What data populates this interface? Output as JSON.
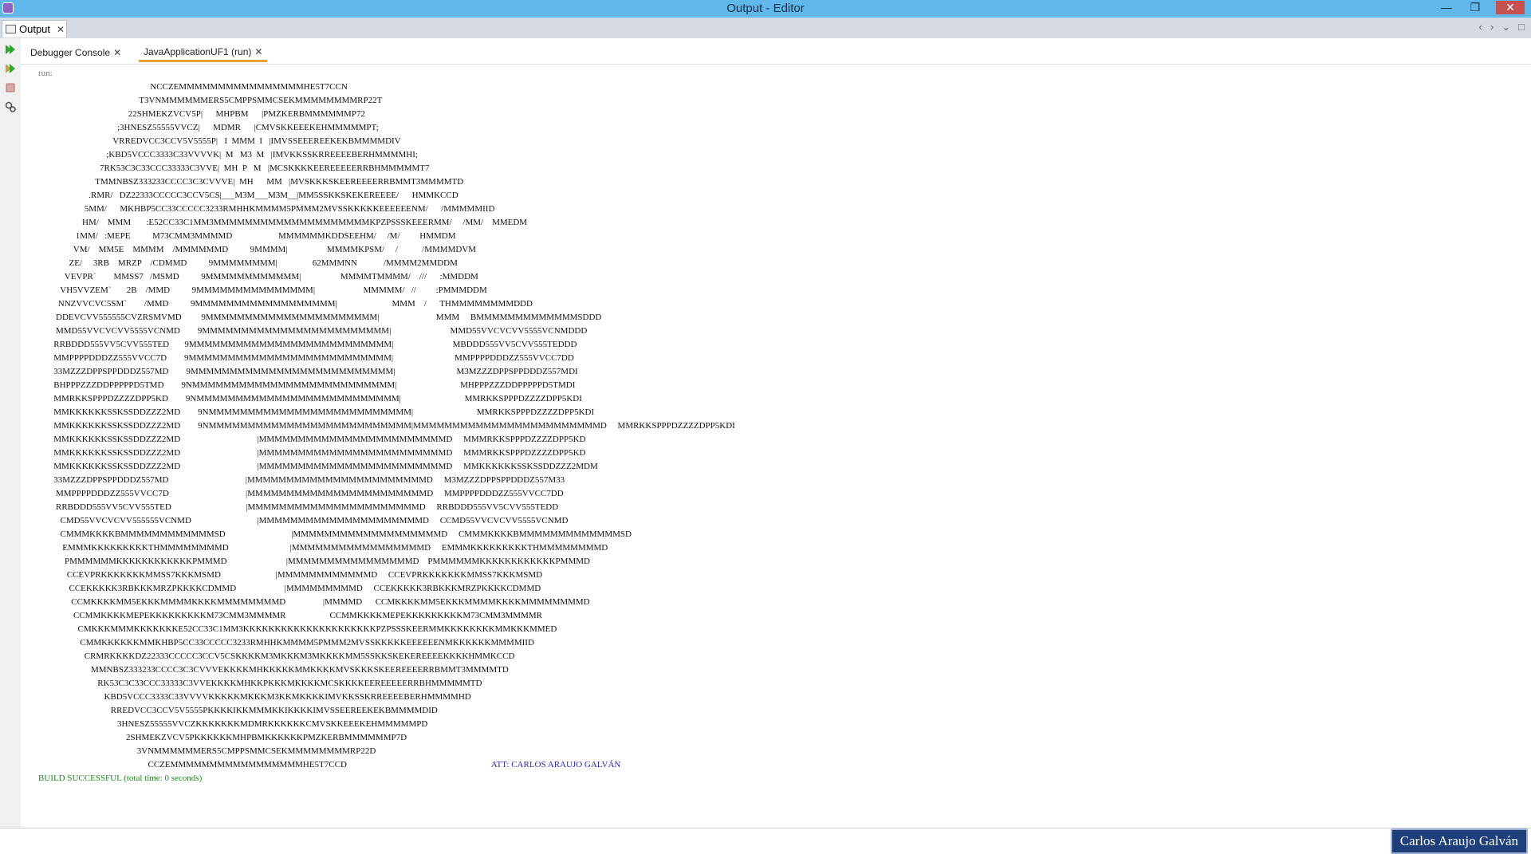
{
  "window": {
    "title": "Output - Editor",
    "controls": [
      "—",
      "❐",
      "✕"
    ]
  },
  "output_panel": {
    "tab_label": "Output",
    "close_glyph": "✕",
    "nav_controls": [
      "‹",
      "›",
      "⌄",
      "□"
    ]
  },
  "subtabs": [
    {
      "label": "Debugger Console",
      "close": "✕"
    },
    {
      "label": "JavaApplicationUF1 (run)",
      "close": "✕"
    }
  ],
  "console": {
    "run_label": "run:",
    "ascii_art": "                                                   NCCZEMMMMMMMMMMMMMMMMHE5T7CCN\n                                              T3VNMMMMMMERS5CMPPSMMCSEKMMMMMMMMRP22T\n                                         22SHMEKZVCV5P|      MHPBM      |PMZKERBMMMMMMP72\n                                    ;3HNESZ55555VVCZ|      MDMR      |CMVSKKEEEKEHMMMMMPT;\n                                  VRREDVCC3CCV5V5555P|   I  MMM  I   |IMVSSEEEREEKEKBMMMMDIV\n                               ;KBD5VCCC3333C33VVVVK|  M   M3  M   |IMVKKSSKRREEEEBERHMMMMHI;\n                            7RK53C3C33CCC33333C3VVE|  MH  P   M   |MCSKKKKEEREEEEERRBHMMMMMT7\n                          TMMNBSZ333233CCCC3C3CVVVE|  MH      MM   |MVSKKKSKEEREEEERRBMMT3MMMMTD\n                       .RMR/   DZ22333CCCCC3CCV5CS|___M3M___M3M__|MM5SSKKSKEKEREEEE/      HMMKCCD\n                     5MM/      MKHBP5CC33CCCCC3233RMHHKMMMM5PMMM2MVSSKKKKKEEEEEENM/      /MMMMMIID\n                    HM/    MMM       :E52CC33C1MM3MMMMMMMMMMMMMMMMMMMMKPZPSSSKEEERMM/     /MM/    MMEDM\n                 1MM/   :MEPE          M73CMM3MMMMD                     MMMMMMKDDSEEHM/     /M/         HMMDM\n                VM/    MM5E    MMMM    /MMMMMMD          9MMMM|                  MMMMKPSM/     /           /MMMMDVM\n              ZE/     3RB    MRZP    /CDMMD          9MMMMMMMM|                62MMMNN            /MMMM2MMDDM\n            VEVPR`        MMSS7   /MSMD          9MMMMMMMMMMMM|                  MMMMTMMMM/    ///      :MMDDM\n          VH5VVZEM`       2B    /MMD          9MMMMMMMMMMMMMMM|                      MMMMM/   //         :PMMMDDM\n         NNZVVCVC5SM`        /MMD          9MMMMMMMMMMMMMMMMMM|                         MMM    /      THMMMMMMMMDDD\n        DDEVCVV555555CVZRSMVMD         9MMMMMMMMMMMMMMMMMMMMMM|                          MMM     BMMMMMMMMMMMMMSDDD\n        MMD55VVCVCVV5555VCNMD        9MMMMMMMMMMMMMMMMMMMMMMMM|                           MMD55VVCVCVV5555VCNMDDD\n       RRBDDD555VV5CVV555TED       9MMMMMMMMMMMMMMMMMMMMMMMMMM|                           MBDDD555VV5CVV555TEDDD\n       MMPPPPDDDZZ555VVCC7D        9MMMMMMMMMMMMMMMMMMMMMMMMMM|                            MMPPPPDDDZZ555VVCC7DD\n       33MZZZDPPSPPDDDZ557MD        9MMMMMMMMMMMMMMMMMMMMMMMMMM|                            M3MZZZDPPSPPDDDZ557MDI\n       BHPPPZZZDDPPPPPD5TMD        9NMMMMMMMMMMMMMMMMMMMMMMMMMM|                             MHPPPZZZDDPPPPPD5TMDI\n       MMRKKSPPPDZZZZDPP5KD        9NMMMMMMMMMMMMMMMMMMMMMMMMMM|                             MMRKKSPPPDZZZZDPP5KDI\n       MMKKKKKKSSKSSDDZZZ2MD        9NMMMMMMMMMMMMMMMMMMMMMMMMMM|                             MMRKKSPPPDZZZZDPP5KDI\n       MMKKKKKKSSKSSDDZZZ2MD        9NMMMMMMMMMMMMMMMMMMMMMMMMMM|MMMMMMMMMMMMMMMMMMMMMMMMD     MMRKKSPPPDZZZZDPP5KDI\n       MMKKKKKKSSKSSDDZZZ2MD                                   |MMMMMMMMMMMMMMMMMMMMMMMMD     MMMRKKSPPPDZZZZDPP5KD\n       MMKKKKKKSSKSSDDZZZ2MD                                   |MMMMMMMMMMMMMMMMMMMMMMMMD     MMMRKKSPPPDZZZZDPP5KD\n       MMKKKKKKSSKSSDDZZZ2MD                                   |MMMMMMMMMMMMMMMMMMMMMMMMD     MMKKKKKKSSKSSDDZZZ2MDM\n       33MZZZDPPSPPDDDZ557MD                                   |MMMMMMMMMMMMMMMMMMMMMMMD     M3MZZZDPPSPPDDDZ557M33\n        MMPPPPDDDZZ555VVCC7D                                   |MMMMMMMMMMMMMMMMMMMMMMMD     MMPPPPDDDZZ555VVCC7DD\n        RRBDDD555VV5CVV555TED                                  |MMMMMMMMMMMMMMMMMMMMMMD     RRBDDD555VV5CVV555TEDD\n          CMD55VVCVCVV555555VCNMD                              |MMMMMMMMMMMMMMMMMMMMMD     CCMD55VVCVCVV5555VCNMD\n          CMMMKKKKBMMMMMMMMMMMMSD                              |MMMMMMMMMMMMMMMMMMMD     CMMMKKKKBMMMMMMMMMMMMMSD\n           EMMMKKKKKKKKKTHMMMMMMMMD                            |MMMMMMMMMMMMMMMMMD     EMMMKKKKKKKKKTHMMMMMMMMD\n            PMMMMMMKKKKKKKKKKKKPMMMD                           |MMMMMMMMMMMMMMMMD    PMMMMMMKKKKKKKKKKKKPMMMD\n             CCEVPRKKKKKKKMMSS7KKKMSMD                         |MMMMMMMMMMMMD     CCEVPRKKKKKKKMMSS7KKKMSMD\n              CCEKKKKK3RBKKKMRZPKKKKCDMMD                      |MMMMMMMMMD     CCEKKKKK3RBKKKMRZPKKKKCDMMD\n               CCMKKKKMM5EKKKMMMMKKKKMMMMMMMMD                 |MMMMD      CCMKKKKMM5EKKKMMMMKKKKMMMMMMMMD\n                CCMMKKKKMEPEKKKKKKKKKM73CMM3MMMMR                    CCMMKKKKMEPEKKKKKKKKKM73CMM3MMMMR\n                  CMKKKMMMKKKKKKKE52CC33C1MM3KKKKKKKKKKKKKKKKKKKKKPZPSSSKEERMMKKKKKKKKMMKKKMMED\n                   CMMKKKKKKMMKHBP5CC33CCCCC3233RMHHKMMMM5PMMM2MVSSKKKKKEEEEEENMKKKKKKMMMMIID\n                     CRMRKKKKDZ22333CCCCC3CCV5CSKKKKM3MKKKM3MKKKKMM5SSKKSKEKEREEEEKKKKHMMKCCD\n                        MMNBSZ333233CCCC3C3CVVVEKKKKMHKKKKKMMKKKKMVSKKKSKEEREEEERRBMMT3MMMMTD\n                           RK53C3C33CCC33333C3VVEKKKKMHKKPKKKMKKKKMCSKKKKEEREEEEERRBHMMMMMTD\n                              KBD5VCCC3333C33VVVVKKKKKMKKKM3KKMKKKKIMVKKSSKRREEEEBERHMMMMHD\n                                 RREDVCC3CCV5V5555PKKKKIKKMMMKKIKKKKIMVSSEEREEKEKBMMMMDID\n                                    3HNESZ55555VVCZKKKKKKKMDMRKKKKKKCMVSKKEEEKEHMMMMMPD\n                                        2SHMEKZVCV5PKKKKKKMHPBMKKKKKKPMZKERBMMMMMMP7D\n                                             3VNMMMMMMERS5CMPPSMMCSEKMMMMMMMMRP22D\n                                                  CCZEMMMMMMMMMMMMMMMMMHE5T7CCD",
    "att_line": "ATT: CARLOS ARAUJO GALVÁN",
    "build_line": "BUILD SUCCESSFUL (total time: 0 seconds)"
  },
  "author_badge": "Carlos Araujo Galván",
  "colors": {
    "title_bar": "#5fb7ea",
    "build_success": "#1c8a1c",
    "att_text": "#2626c8",
    "badge_bg": "#1f3f7a"
  },
  "icons": [
    "app-icon",
    "output-icon",
    "run-icon",
    "rerun-icon",
    "stop-icon",
    "settings-icon"
  ]
}
